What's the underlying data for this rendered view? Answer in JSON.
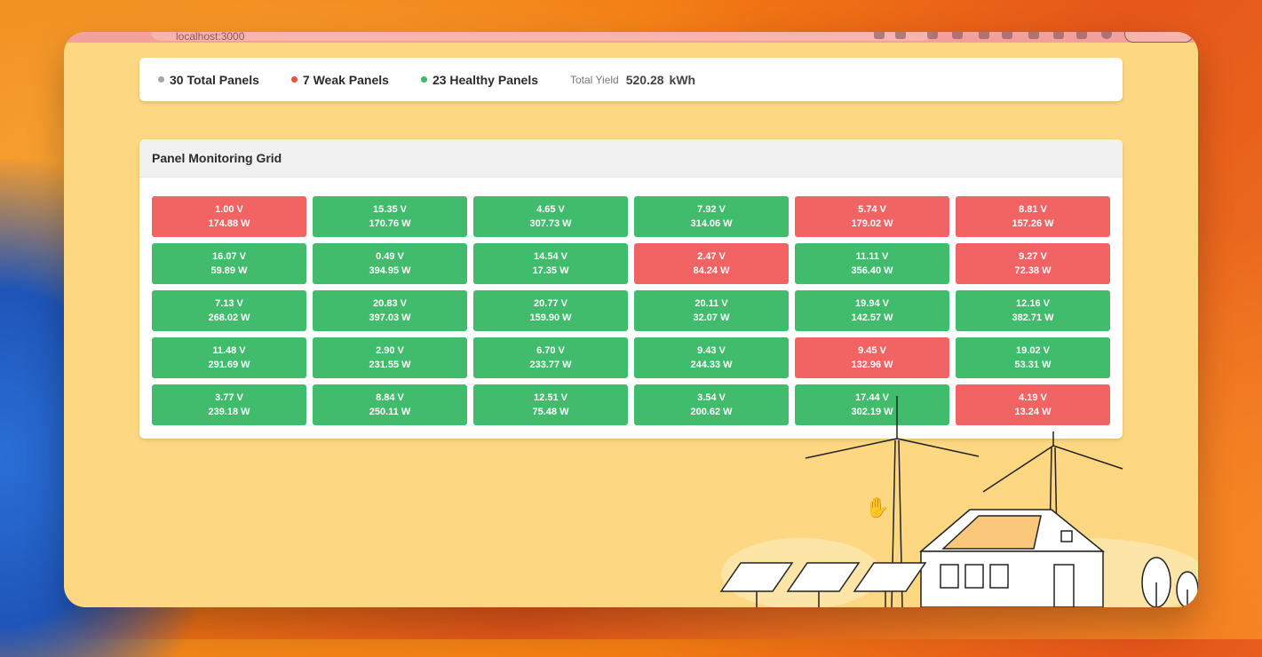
{
  "browser": {
    "url": "localhost:3000"
  },
  "stats": {
    "total": {
      "label": "30 Total Panels",
      "color": "#a6a6a6"
    },
    "weak": {
      "label": "7 Weak Panels",
      "color": "#e8513f"
    },
    "healthy": {
      "label": "23 Healthy Panels",
      "color": "#3dbb6a"
    },
    "yield_label": "Total Yield",
    "yield_value": "520.28",
    "yield_unit": "kWh"
  },
  "grid": {
    "title": "Panel Monitoring Grid",
    "panels": [
      {
        "voltage": "1.00 V",
        "power": "174.88 W",
        "status": "weak"
      },
      {
        "voltage": "15.35 V",
        "power": "170.76 W",
        "status": "healthy"
      },
      {
        "voltage": "4.65 V",
        "power": "307.73 W",
        "status": "healthy"
      },
      {
        "voltage": "7.92 V",
        "power": "314.06 W",
        "status": "healthy"
      },
      {
        "voltage": "5.74 V",
        "power": "179.02 W",
        "status": "weak"
      },
      {
        "voltage": "8.81 V",
        "power": "157.26 W",
        "status": "weak"
      },
      {
        "voltage": "16.07 V",
        "power": "59.89 W",
        "status": "healthy"
      },
      {
        "voltage": "0.49 V",
        "power": "394.95 W",
        "status": "healthy"
      },
      {
        "voltage": "14.54 V",
        "power": "17.35 W",
        "status": "healthy"
      },
      {
        "voltage": "2.47 V",
        "power": "84.24 W",
        "status": "weak"
      },
      {
        "voltage": "11.11 V",
        "power": "356.40 W",
        "status": "healthy"
      },
      {
        "voltage": "9.27 V",
        "power": "72.38 W",
        "status": "weak"
      },
      {
        "voltage": "7.13 V",
        "power": "268.02 W",
        "status": "healthy"
      },
      {
        "voltage": "20.83 V",
        "power": "397.03 W",
        "status": "healthy"
      },
      {
        "voltage": "20.77 V",
        "power": "159.90 W",
        "status": "healthy"
      },
      {
        "voltage": "20.11 V",
        "power": "32.07 W",
        "status": "healthy"
      },
      {
        "voltage": "19.94 V",
        "power": "142.57 W",
        "status": "healthy"
      },
      {
        "voltage": "12.16 V",
        "power": "382.71 W",
        "status": "healthy"
      },
      {
        "voltage": "11.48 V",
        "power": "291.69 W",
        "status": "healthy"
      },
      {
        "voltage": "2.90 V",
        "power": "231.55 W",
        "status": "healthy"
      },
      {
        "voltage": "6.70 V",
        "power": "233.77 W",
        "status": "healthy"
      },
      {
        "voltage": "9.43 V",
        "power": "244.33 W",
        "status": "healthy"
      },
      {
        "voltage": "9.45 V",
        "power": "132.96 W",
        "status": "weak"
      },
      {
        "voltage": "19.02 V",
        "power": "53.31 W",
        "status": "healthy"
      },
      {
        "voltage": "3.77 V",
        "power": "239.18 W",
        "status": "healthy"
      },
      {
        "voltage": "8.84 V",
        "power": "250.11 W",
        "status": "healthy"
      },
      {
        "voltage": "12.51 V",
        "power": "75.48 W",
        "status": "healthy"
      },
      {
        "voltage": "3.54 V",
        "power": "200.62 W",
        "status": "healthy"
      },
      {
        "voltage": "17.44 V",
        "power": "302.19 W",
        "status": "healthy"
      },
      {
        "voltage": "4.19 V",
        "power": "13.24 W",
        "status": "weak"
      }
    ]
  },
  "icons": {
    "cursor": "hand-pointer-icon",
    "illustration": "solar-farm-illustration"
  }
}
